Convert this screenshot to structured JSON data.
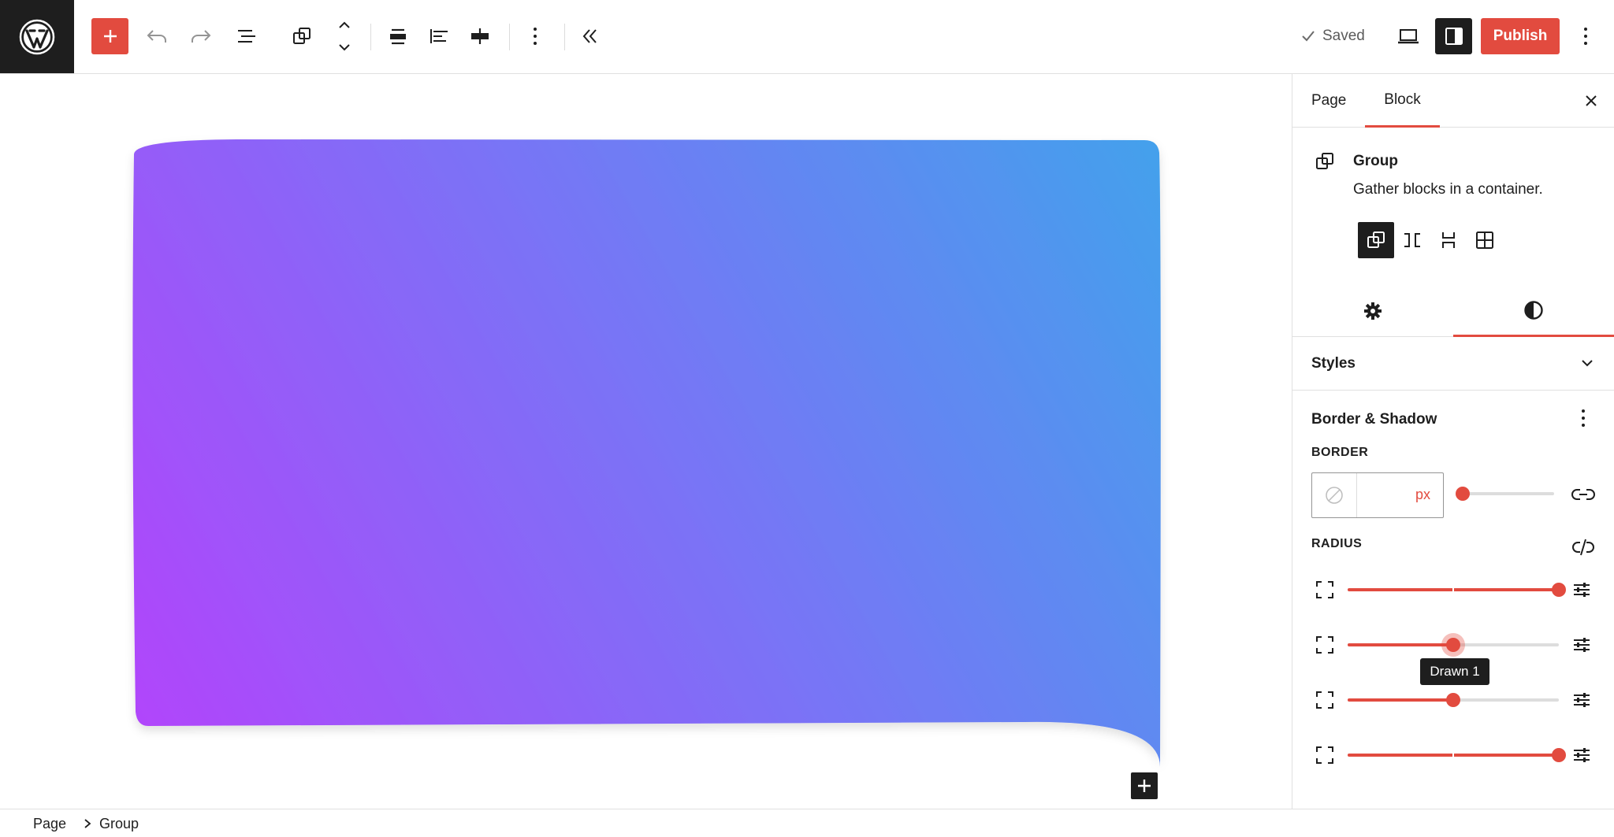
{
  "toolbar": {
    "saved_label": "Saved",
    "publish_label": "Publish",
    "icons": [
      "wordpress-logo",
      "plus-icon",
      "undo-icon",
      "redo-icon",
      "list-view-icon",
      "group-block-icon",
      "move-up-down-icon",
      "align-center-icon",
      "justify-left-icon",
      "justify-stretch-icon",
      "options-icon",
      "collapse-icon",
      "check-icon",
      "desktop-view-icon",
      "sidebar-icon",
      "more-vertical-icon"
    ]
  },
  "colors": {
    "accent": "#e24b3f",
    "dark": "#1e1e1e",
    "gradient_start": "#b145fb",
    "gradient_mid": "#7a73f6",
    "gradient_end": "#43a1ec"
  },
  "sidebar": {
    "tabs": [
      {
        "label": "Page"
      },
      {
        "label": "Block"
      }
    ],
    "active_tab": "Block",
    "block": {
      "title": "Group",
      "description": "Gather blocks in a container.",
      "variations": [
        "group-icon",
        "row-icon",
        "stack-icon",
        "grid-icon"
      ]
    },
    "styles_label": "Styles",
    "border_shadow": {
      "title": "Border & Shadow",
      "border_label": "BORDER",
      "border_value": "",
      "border_unit": "px",
      "border_slider": 0,
      "radius_label": "RADIUS",
      "radius_sliders": [
        1.0,
        0.5,
        0.5,
        1.0
      ],
      "tooltip": "Drawn 1"
    }
  },
  "breadcrumb": {
    "items": [
      {
        "label": "Page"
      },
      {
        "label": "Group"
      }
    ]
  }
}
